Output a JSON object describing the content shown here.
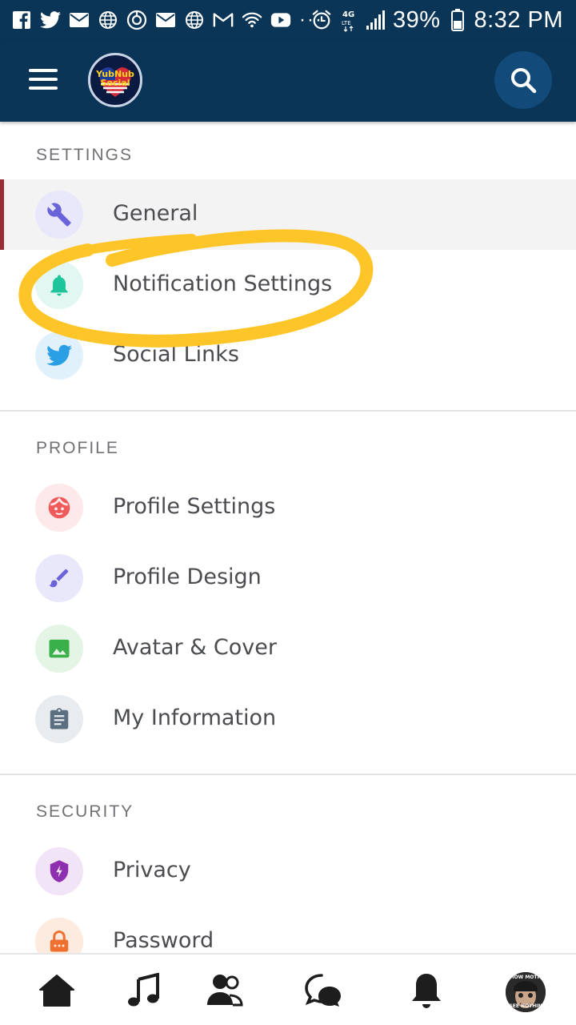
{
  "status_bar": {
    "battery": "39%",
    "time": "8:32 PM",
    "overflow": "···",
    "left_icons": [
      "facebook-icon",
      "twitter-icon",
      "mail-icon",
      "globe-icon",
      "sync-icon",
      "mail-icon",
      "globe-icon",
      "gmail-icon",
      "wifi-icon",
      "youtube-icon"
    ],
    "right_icons": [
      "alarm-icon",
      "4g-lte-icon",
      "signal-icon",
      "battery-icon"
    ]
  },
  "app_bar": {
    "logo_text_line1": "YubNub",
    "logo_text_line2": "Social",
    "menu_icon": "hamburger-menu-icon",
    "search_icon": "search-icon",
    "colors": {
      "bar": "#0b3556",
      "search_circle": "#124a7a"
    }
  },
  "sections": [
    {
      "title": "SETTINGS",
      "items": [
        {
          "label": "General",
          "icon": "wrench-icon",
          "icon_color": "#6b63d9",
          "icon_bg": "#e9e8fb",
          "active": true
        },
        {
          "label": "Notification Settings",
          "icon": "bell-icon",
          "icon_color": "#1fc59a",
          "icon_bg": "#e2f7f1"
        },
        {
          "label": "Social Links",
          "icon": "twitter-icon",
          "icon_color": "#2b9fe6",
          "icon_bg": "#e1f1fc"
        }
      ]
    },
    {
      "title": "PROFILE",
      "items": [
        {
          "label": "Profile Settings",
          "icon": "face-icon",
          "icon_color": "#ef5b5b",
          "icon_bg": "#fde9e9"
        },
        {
          "label": "Profile Design",
          "icon": "brush-icon",
          "icon_color": "#6b63d9",
          "icon_bg": "#e9e8fb"
        },
        {
          "label": "Avatar & Cover",
          "icon": "image-icon",
          "icon_color": "#39b04a",
          "icon_bg": "#e4f5e6"
        },
        {
          "label": "My Information",
          "icon": "clipboard-icon",
          "icon_color": "#5c6f80",
          "icon_bg": "#e8ecef"
        }
      ]
    },
    {
      "title": "SECURITY",
      "items": [
        {
          "label": "Privacy",
          "icon": "shield-bolt-icon",
          "icon_color": "#8e2fb0",
          "icon_bg": "#f2e4f7"
        },
        {
          "label": "Password",
          "icon": "lock-icon",
          "icon_color": "#f07030",
          "icon_bg": "#fdebe0"
        }
      ]
    }
  ],
  "bottom_nav": {
    "items": [
      "home-icon",
      "music-icon",
      "friends-icon",
      "messages-icon",
      "notifications-icon",
      "avatar"
    ],
    "avatar_caption_top": "HOW MOTH",
    "avatar_caption_bottom": "SEE NOTHIN"
  },
  "annotation": {
    "highlight_color": "#fdc528"
  }
}
